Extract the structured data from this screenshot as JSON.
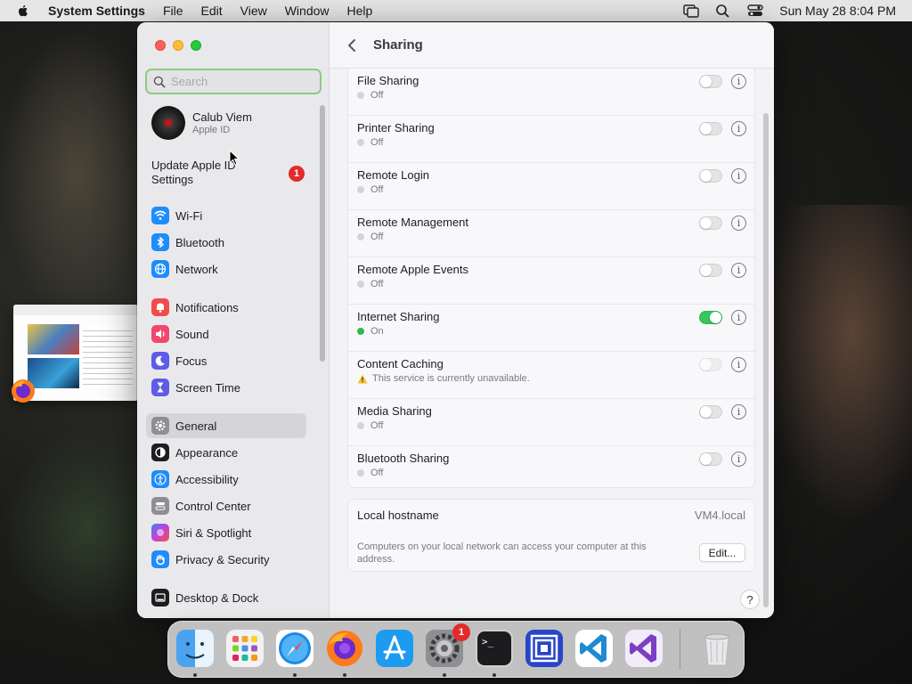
{
  "menubar": {
    "app_name": "System Settings",
    "menus": [
      "File",
      "Edit",
      "View",
      "Window",
      "Help"
    ],
    "clock": "Sun May 28  8:04 PM"
  },
  "sidebar": {
    "search_placeholder": "Search",
    "account": {
      "name": "Calub Viem",
      "subtitle": "Apple ID"
    },
    "update": {
      "label_line1": "Update Apple ID",
      "label_line2": "Settings",
      "badge": "1"
    },
    "items": [
      {
        "label": "Wi-Fi",
        "icon": "wifi-icon",
        "color": "#1f8cf9"
      },
      {
        "label": "Bluetooth",
        "icon": "bluetooth-icon",
        "color": "#1f8cf9"
      },
      {
        "label": "Network",
        "icon": "globe-icon",
        "color": "#1f8cf9"
      },
      {
        "label": "Notifications",
        "icon": "bell-icon",
        "color": "#f34b4b"
      },
      {
        "label": "Sound",
        "icon": "speaker-icon",
        "color": "#f2476d"
      },
      {
        "label": "Focus",
        "icon": "moon-icon",
        "color": "#5e5ce6"
      },
      {
        "label": "Screen Time",
        "icon": "hourglass-icon",
        "color": "#5e5ce6"
      },
      {
        "label": "General",
        "icon": "gear-icon",
        "color": "#8e8e93"
      },
      {
        "label": "Appearance",
        "icon": "appearance-icon",
        "color": "#1d1d1f"
      },
      {
        "label": "Accessibility",
        "icon": "accessibility-icon",
        "color": "#1f8cf9"
      },
      {
        "label": "Control Center",
        "icon": "control-center-icon",
        "color": "#8e8e93"
      },
      {
        "label": "Siri & Spotlight",
        "icon": "siri-icon",
        "color": "#c142d6"
      },
      {
        "label": "Privacy & Security",
        "icon": "hand-icon",
        "color": "#1f8cf9"
      },
      {
        "label": "Desktop & Dock",
        "icon": "dock-icon",
        "color": "#1d1d1f"
      }
    ],
    "selected": "General"
  },
  "main": {
    "title": "Sharing",
    "services": [
      {
        "name": "File Sharing",
        "status": "Off",
        "state": "off"
      },
      {
        "name": "Printer Sharing",
        "status": "Off",
        "state": "off"
      },
      {
        "name": "Remote Login",
        "status": "Off",
        "state": "off"
      },
      {
        "name": "Remote Management",
        "status": "Off",
        "state": "off"
      },
      {
        "name": "Remote Apple Events",
        "status": "Off",
        "state": "off"
      },
      {
        "name": "Internet Sharing",
        "status": "On",
        "state": "on"
      },
      {
        "name": "Content Caching",
        "status": "This service is currently unavailable.",
        "state": "unavailable"
      },
      {
        "name": "Media Sharing",
        "status": "Off",
        "state": "off"
      },
      {
        "name": "Bluetooth Sharing",
        "status": "Off",
        "state": "off"
      }
    ],
    "info_glyph": "i",
    "hostname": {
      "label": "Local hostname",
      "value": "VM4.local",
      "description": "Computers on your local network can access your computer at this address.",
      "edit_label": "Edit..."
    },
    "help_label": "?"
  },
  "dock": {
    "apps": [
      {
        "name": "Finder",
        "running": true
      },
      {
        "name": "Launchpad",
        "running": false
      },
      {
        "name": "Safari",
        "running": true
      },
      {
        "name": "Firefox",
        "running": true
      },
      {
        "name": "App Store",
        "running": false
      },
      {
        "name": "System Settings",
        "running": true,
        "badge": "1"
      },
      {
        "name": "Terminal",
        "running": true
      },
      {
        "name": "Remote Desktop",
        "running": false
      },
      {
        "name": "Visual Studio Code",
        "running": false
      },
      {
        "name": "Visual Studio",
        "running": false
      }
    ],
    "terminal_prompt": ">_"
  },
  "colors": {
    "accent_green": "#34c759",
    "badge_red": "#e32b2b",
    "search_focus": "#8fc985"
  }
}
